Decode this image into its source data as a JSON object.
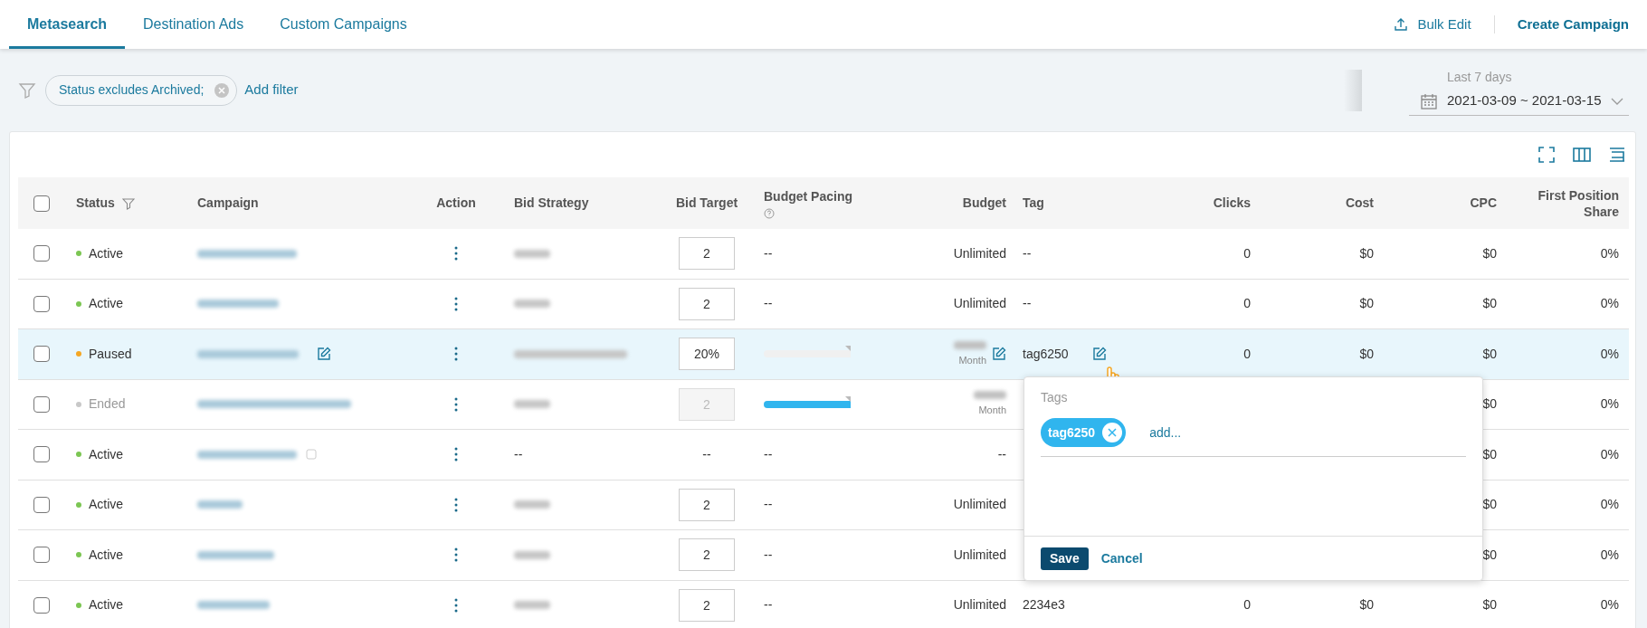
{
  "tabs": [
    {
      "label": "Metasearch",
      "selected": true
    },
    {
      "label": "Destination Ads",
      "selected": false
    },
    {
      "label": "Custom Campaigns",
      "selected": false
    }
  ],
  "header_actions": {
    "bulk_edit": "Bulk Edit",
    "create": "Create Campaign"
  },
  "filters": {
    "chips": [
      "Status excludes Archived;"
    ],
    "add": "Add filter"
  },
  "date_range": {
    "label": "Last 7 days",
    "value": "2021-03-09 ~ 2021-03-15"
  },
  "table": {
    "select_all_checked": false,
    "columns": [
      "Status",
      "Campaign",
      "Action",
      "Bid Strategy",
      "Bid Target",
      "Budget Pacing",
      "Budget",
      "Tag",
      "Clicks",
      "Cost",
      "CPC",
      "First Position Share"
    ],
    "rows": [
      {
        "checked": false,
        "status": "Active",
        "color": "#7cc653",
        "disabled": false,
        "highlighted": false,
        "bid_target": "2",
        "pacing": "--",
        "budget": "Unlimited",
        "tag": "--",
        "clicks": "0",
        "cost": "$0",
        "cpc": "$0",
        "fps": "0%"
      },
      {
        "checked": false,
        "status": "Active",
        "color": "#7cc653",
        "disabled": false,
        "highlighted": false,
        "bid_target": "2",
        "pacing": "--",
        "budget": "Unlimited",
        "tag": "--",
        "clicks": "0",
        "cost": "$0",
        "cpc": "$0",
        "fps": "0%"
      },
      {
        "checked": false,
        "status": "Paused",
        "color": "#f5a623",
        "disabled": false,
        "highlighted": true,
        "bid_target": "20%",
        "pacing": {
          "level": 0
        },
        "budget_period": "Month",
        "tag": "tag6250",
        "clicks": "0",
        "cost": "$0",
        "cpc": "$0",
        "fps": "0%"
      },
      {
        "checked": false,
        "status": "Ended",
        "color": "#c8c8c8",
        "disabled": true,
        "highlighted": false,
        "bid_target": "2",
        "pacing": {
          "level": 1
        },
        "budget_period": "Month",
        "cpc": "$0",
        "fps": "0%"
      },
      {
        "checked": false,
        "status": "Active",
        "color": "#7cc653",
        "disabled": false,
        "highlighted": false,
        "info": true,
        "bid_strategy": "--",
        "bid_target_text": "--",
        "pacing": "--",
        "budget": "--",
        "cpc": "$0",
        "fps": "0%"
      },
      {
        "checked": false,
        "status": "Active",
        "color": "#7cc653",
        "disabled": false,
        "highlighted": false,
        "bid_target": "2",
        "pacing": "--",
        "budget": "Unlimited",
        "cpc": "$0",
        "fps": "0%"
      },
      {
        "checked": false,
        "status": "Active",
        "color": "#7cc653",
        "disabled": false,
        "highlighted": false,
        "bid_target": "2",
        "pacing": "--",
        "budget": "Unlimited",
        "cpc": "$0",
        "fps": "0%"
      },
      {
        "checked": false,
        "status": "Active",
        "color": "#7cc653",
        "disabled": false,
        "highlighted": false,
        "bid_target": "2",
        "pacing": "--",
        "budget": "Unlimited",
        "tag": "2234e3",
        "clicks": "0",
        "cost": "$0",
        "cpc": "$0",
        "fps": "0%"
      }
    ]
  },
  "tag_popup": {
    "label": "Tags",
    "tags": [
      "tag6250"
    ],
    "add": "add...",
    "save": "Save",
    "cancel": "Cancel"
  }
}
